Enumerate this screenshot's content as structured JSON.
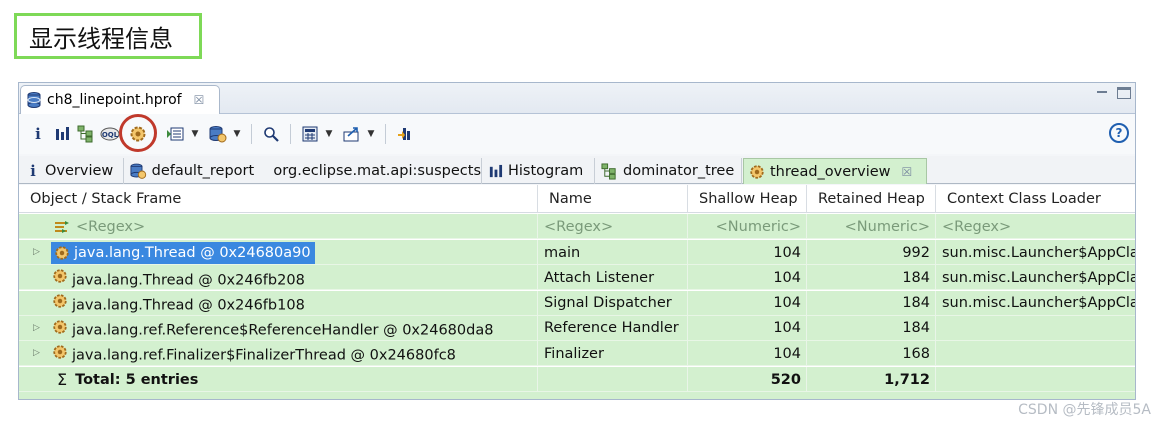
{
  "heading": {
    "text": "显示线程信息"
  },
  "editor": {
    "tab_label": "ch8_linepoint.hprof",
    "tab_close": "☒"
  },
  "toolbar": {
    "help": "?"
  },
  "result_tabs": [
    {
      "label": "Overview",
      "icon": "info-icon"
    },
    {
      "label": "default_report",
      "label2": "org.eclipse.mat.api:suspects",
      "icon": "report-icon"
    },
    {
      "label": "Histogram",
      "icon": "histogram-icon"
    },
    {
      "label": "dominator_tree",
      "icon": "dominator-tree-icon"
    },
    {
      "label": "thread_overview",
      "icon": "thread-gear-icon",
      "close": "☒"
    }
  ],
  "columns": {
    "object": "Object / Stack Frame",
    "name": "Name",
    "shallow": "Shallow Heap",
    "retained": "Retained Heap",
    "loader": "Context Class Loader"
  },
  "filter_row": {
    "object": "<Regex>",
    "name": "<Regex>",
    "shallow": "<Numeric>",
    "retained": "<Numeric>",
    "loader": "<Regex>"
  },
  "rows": [
    {
      "object": "java.lang.Thread @ 0x24680a90",
      "name": "main",
      "shallow": "104",
      "retained": "992",
      "loader": "sun.misc.Launcher$AppCla",
      "expander": "▷"
    },
    {
      "object": "java.lang.Thread @ 0x246fb208",
      "name": "Attach Listener",
      "shallow": "104",
      "retained": "184",
      "loader": "sun.misc.Launcher$AppCla",
      "expander": ""
    },
    {
      "object": "java.lang.Thread @ 0x246fb108",
      "name": "Signal Dispatcher",
      "shallow": "104",
      "retained": "184",
      "loader": "sun.misc.Launcher$AppCla",
      "expander": ""
    },
    {
      "object": "java.lang.ref.Reference$ReferenceHandler @ 0x24680da8",
      "name": "Reference Handler",
      "shallow": "104",
      "retained": "184",
      "loader": "",
      "expander": "▷"
    },
    {
      "object": "java.lang.ref.Finalizer$FinalizerThread @ 0x24680fc8",
      "name": "Finalizer",
      "shallow": "104",
      "retained": "168",
      "loader": "",
      "expander": "▷"
    }
  ],
  "total_row": {
    "sigma": "Σ",
    "label": "Total: 5 entries",
    "shallow": "520",
    "retained": "1,712"
  },
  "colors": {
    "row_background": "#d3f0cf",
    "selection": "#3a88e0",
    "heading_border": "#7ed957",
    "highlight_ring": "#c0392b"
  },
  "watermark": "CSDN @先锋成员5A"
}
